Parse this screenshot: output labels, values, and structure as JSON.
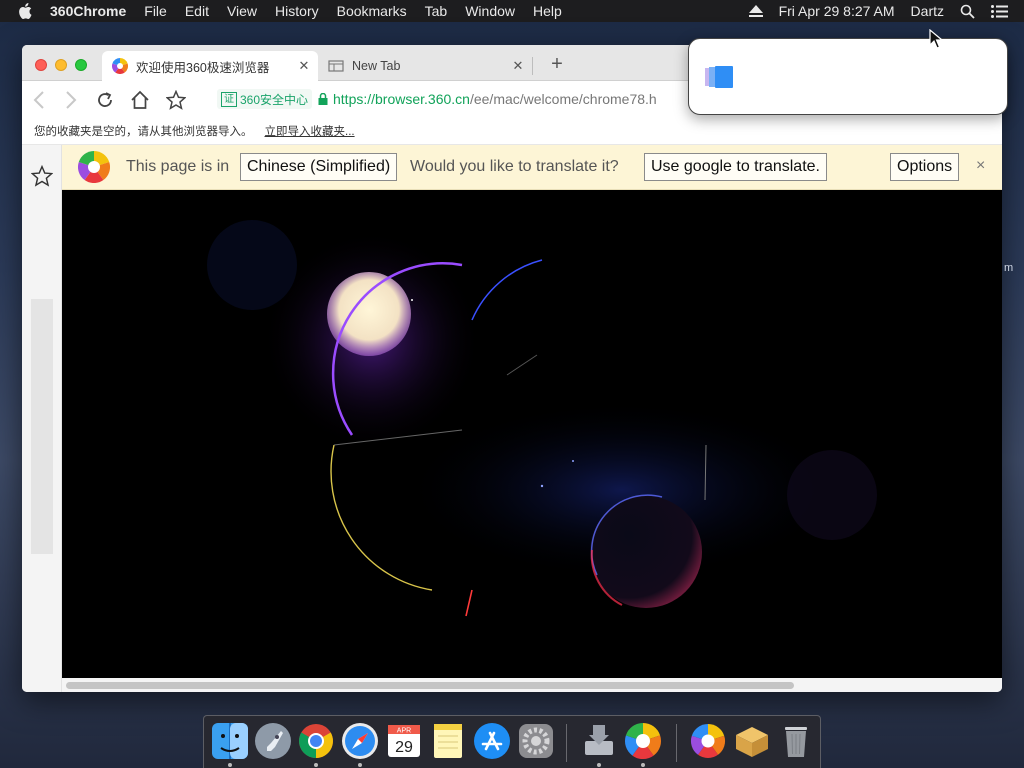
{
  "menubar": {
    "app_name": "360Chrome",
    "items": [
      "File",
      "Edit",
      "View",
      "History",
      "Bookmarks",
      "Tab",
      "Window",
      "Help"
    ],
    "datetime": "Fri Apr 29  8:27 AM",
    "user": "Dartz"
  },
  "browser": {
    "tabs": [
      {
        "title": "欢迎使用360极速浏览器",
        "active": true
      },
      {
        "title": "New Tab",
        "active": false
      }
    ],
    "security_badge": {
      "glyph": "证",
      "label": "360安全中心"
    },
    "url": {
      "scheme_host": "https://browser.360.cn",
      "path": "/ee/mac/welcome/chrome78.h"
    },
    "bookmark_bar": {
      "empty_message": "您的收藏夹是空的，请从其他浏览器导入。",
      "import_link": "立即导入收藏夹..."
    },
    "translate_bar": {
      "prefix": "This page is in",
      "language": "Chinese (Simplified)",
      "question": "Would you like to translate it?",
      "translate_button": "Use google to translate.",
      "options_button": "Options",
      "close": "×"
    }
  },
  "desktop": {
    "edge_text": "m"
  },
  "dock": {
    "calendar_month": "APR",
    "calendar_day": "29",
    "items": [
      "finder",
      "launchpad",
      "chrome",
      "safari",
      "calendar",
      "notes",
      "app-store",
      "system-preferences",
      "downloads",
      "360chrome",
      "360chrome-alt",
      "archive-utility",
      "trash"
    ]
  },
  "colors": {
    "translate_bar_bg": "#fdf5d6",
    "secure_green": "#1aa36a",
    "url_host_green": "#12a35a"
  }
}
